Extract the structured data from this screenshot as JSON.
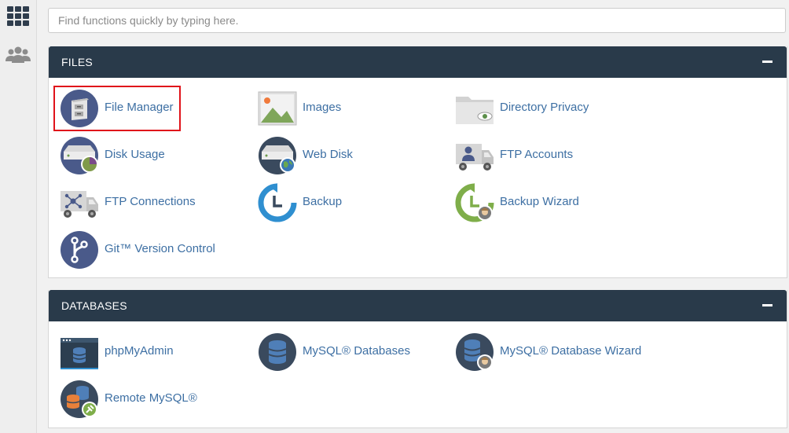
{
  "search": {
    "placeholder": "Find functions quickly by typing here."
  },
  "sidebar": {
    "items": [
      {
        "icon": "grid-icon"
      },
      {
        "icon": "users-icon"
      }
    ]
  },
  "files": {
    "title": "FILES",
    "items": [
      {
        "label": "File Manager",
        "icon": "file-manager-icon"
      },
      {
        "label": "Images",
        "icon": "images-icon"
      },
      {
        "label": "Directory Privacy",
        "icon": "directory-privacy-icon"
      },
      {
        "label": "Disk Usage",
        "icon": "disk-usage-icon"
      },
      {
        "label": "Web Disk",
        "icon": "web-disk-icon"
      },
      {
        "label": "FTP Accounts",
        "icon": "ftp-accounts-icon"
      },
      {
        "label": "FTP Connections",
        "icon": "ftp-connections-icon"
      },
      {
        "label": "Backup",
        "icon": "backup-icon"
      },
      {
        "label": "Backup Wizard",
        "icon": "backup-wizard-icon"
      },
      {
        "label": "Git™ Version Control",
        "icon": "git-icon"
      }
    ]
  },
  "databases": {
    "title": "DATABASES",
    "items": [
      {
        "label": "phpMyAdmin",
        "icon": "phpmyadmin-icon"
      },
      {
        "label": "MySQL® Databases",
        "icon": "mysql-databases-icon"
      },
      {
        "label": "MySQL® Database Wizard",
        "icon": "mysql-wizard-icon"
      },
      {
        "label": "Remote MySQL®",
        "icon": "remote-mysql-icon"
      }
    ]
  },
  "colors": {
    "header": "#293a4a",
    "link": "#3d6fa3",
    "highlight": "#e0131a",
    "icon_navy": "#4a5a8a"
  }
}
